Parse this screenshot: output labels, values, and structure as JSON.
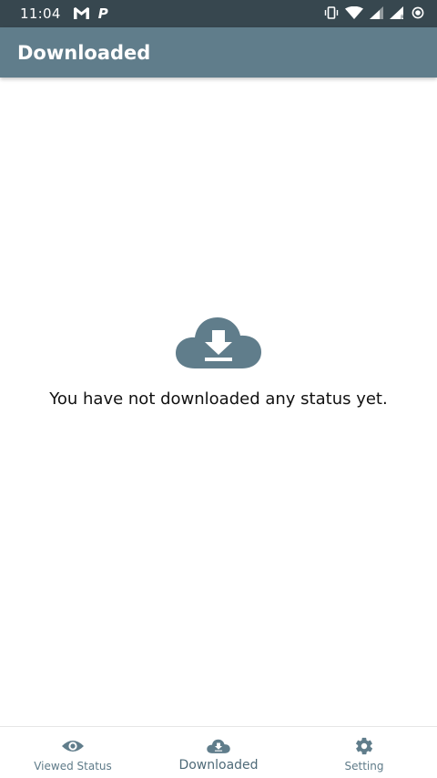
{
  "status_bar": {
    "time": "11:04",
    "left_icons": [
      "gmail-icon",
      "p-icon"
    ],
    "p_icon_text": "P",
    "right_icons": [
      "vibrate-icon",
      "wifi-icon",
      "signal-icon",
      "signal-r-icon",
      "alarm-icon"
    ]
  },
  "app_bar": {
    "title": "Downloaded"
  },
  "empty_state": {
    "icon": "cloud-download-icon",
    "message": "You have not downloaded any status yet."
  },
  "bottom_nav": {
    "items": [
      {
        "label": "Viewed Status",
        "icon": "eye-icon",
        "active": false
      },
      {
        "label": "Downloaded",
        "icon": "cloud-download-icon",
        "active": true
      },
      {
        "label": "Setting",
        "icon": "gear-icon",
        "active": false
      }
    ]
  },
  "colors": {
    "status_bar": "#37474f",
    "app_bar": "#607d8b",
    "icon": "#607d8b",
    "background": "#ffffff",
    "text": "#111111"
  }
}
